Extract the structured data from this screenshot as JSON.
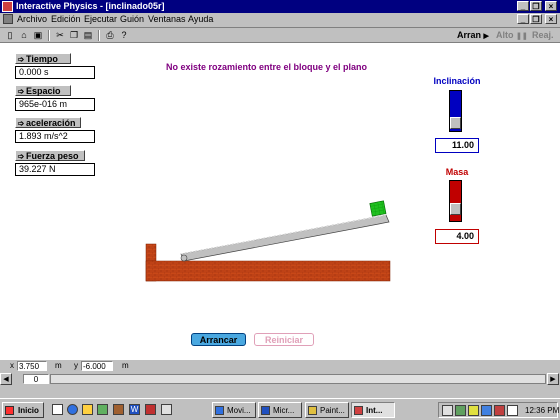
{
  "window": {
    "title": "Interactive Physics - [inclinado05r]"
  },
  "menu": {
    "items": [
      "Archivo",
      "Edición",
      "Ejecutar",
      "Guión",
      "Ventanas",
      "Ayuda"
    ]
  },
  "toolbar": {
    "run_label": "Arran",
    "stop_label": "Alto",
    "reset_label": "Reaj."
  },
  "simulation": {
    "heading": "No existe rozamiento entre el bloque y el plano",
    "meters": [
      {
        "label": "Tiempo",
        "value": "0.000 s"
      },
      {
        "label": "Espacio",
        "value": "965e-016 m"
      },
      {
        "label": "aceleración",
        "value": "1.893 m/s^2"
      },
      {
        "label": "Fuerza peso",
        "value": "39.227 N"
      }
    ],
    "inclination": {
      "label": "Inclinación",
      "value": "11.00",
      "color": "#0000c0"
    },
    "mass": {
      "label": "Masa",
      "value": "4.00",
      "color": "#c00000"
    },
    "buttons": {
      "start": "Arrancar",
      "reset": "Reiniciar"
    }
  },
  "coords": {
    "x_label": "x",
    "x_value": "3.750",
    "x_unit": "m",
    "y_label": "y",
    "y_value": "-6.000",
    "y_unit": "m"
  },
  "scroll": {
    "frame_value": "0"
  },
  "taskbar": {
    "start_label": "Inicio",
    "tasks": [
      "Movi...",
      "Micr...",
      "Paint...",
      "Int..."
    ],
    "clock": "12:36 PM"
  },
  "colors": {
    "block": "#20c020",
    "ramp": "#c0c0c0",
    "brick": "#c84818",
    "heading": "#800080",
    "start_button": "#4aa8e0",
    "reset_button_text": "#e0a0b8"
  }
}
